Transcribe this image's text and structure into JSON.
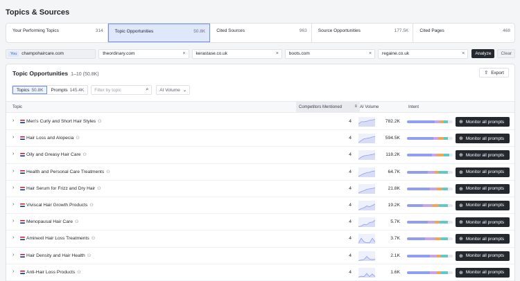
{
  "page": {
    "title": "Topics & Sources"
  },
  "tabs": [
    {
      "label": "Your Performing Topics",
      "count": "314"
    },
    {
      "label": "Topic Opportunities",
      "count": "50.8K",
      "active": true
    },
    {
      "label": "Cited Sources",
      "count": "963"
    },
    {
      "label": "Source Opportunities",
      "count": "177.5K"
    },
    {
      "label": "Cited Pages",
      "count": "468"
    }
  ],
  "domains": {
    "you_badge": "You",
    "you": "champohaircare.com",
    "competitors": [
      "theordinary.com",
      "kerastase.co.uk",
      "boots.com",
      "regaine.co.uk"
    ],
    "analyze_label": "Analyze",
    "clear_label": "Clear"
  },
  "panel": {
    "title": "Topic Opportunities",
    "range": "1–10 (50.8K)",
    "export_label": "Export",
    "filters": {
      "topics_label": "Topics",
      "topics_count": "50.8K",
      "prompts_label": "Prompts",
      "prompts_count": "145.4K",
      "search_placeholder": "Filter by topic",
      "volume_dropdown": "AI Volume"
    },
    "columns": {
      "topic": "Topic",
      "competitors": "Competitors Mentioned",
      "volume": "AI Volume",
      "intent": "Intent"
    },
    "monitor_label": "Monitor all prompts",
    "colors": {
      "accent": "#6e8fe8",
      "dark_button": "#24292f"
    },
    "rows": [
      {
        "topic": "Men's Curly and Short Hair Styles",
        "competitors": "4",
        "volume": "782.2K",
        "trend": [
          0.3,
          0.55,
          0.55,
          0.6,
          0.7,
          0.75,
          0.8
        ],
        "intent": [
          0.6,
          0.12,
          0.08,
          0.1,
          0.1
        ]
      },
      {
        "topic": "Hair Loss and Alopecia",
        "competitors": "4",
        "volume": "594.5K",
        "trend": [
          0.1,
          0.3,
          0.5,
          0.55,
          0.6,
          0.7,
          0.75
        ],
        "intent": [
          0.58,
          0.1,
          0.12,
          0.1,
          0.1
        ]
      },
      {
        "topic": "Oily and Greasy Hair Care",
        "competitors": "4",
        "volume": "118.2K",
        "trend": [
          0.1,
          0.3,
          0.45,
          0.5,
          0.55,
          0.6,
          0.7
        ],
        "intent": [
          0.55,
          0.1,
          0.15,
          0.12,
          0.08
        ]
      },
      {
        "topic": "Health and Personal Care Treatments",
        "competitors": "4",
        "volume": "64.7K",
        "trend": [
          0.1,
          0.25,
          0.4,
          0.5,
          0.55,
          0.65,
          0.7
        ],
        "intent": [
          0.45,
          0.15,
          0.1,
          0.2,
          0.1
        ]
      },
      {
        "topic": "Hair Serum for Frizz and Dry Hair",
        "competitors": "4",
        "volume": "21.8K",
        "trend": [
          0.1,
          0.25,
          0.35,
          0.5,
          0.55,
          0.6,
          0.65
        ],
        "intent": [
          0.5,
          0.15,
          0.12,
          0.13,
          0.1
        ]
      },
      {
        "topic": "Viviscal Hair Growth Products",
        "competitors": "4",
        "volume": "19.2K",
        "trend": [
          0.05,
          0.2,
          0.3,
          0.5,
          0.4,
          0.55,
          0.7
        ],
        "intent": [
          0.35,
          0.2,
          0.15,
          0.2,
          0.1
        ]
      },
      {
        "topic": "Menopausal Hair Care",
        "competitors": "4",
        "volume": "5.7K",
        "trend": [
          0.05,
          0.1,
          0.3,
          0.25,
          0.5,
          0.55,
          0.75
        ],
        "intent": [
          0.45,
          0.15,
          0.12,
          0.18,
          0.1
        ]
      },
      {
        "topic": "Aminexil Hair Loss Treatments",
        "competitors": "4",
        "volume": "3.7K",
        "trend": [
          0.05,
          0.6,
          0.2,
          0.1,
          0.1,
          0.6,
          0.2
        ],
        "intent": [
          0.4,
          0.2,
          0.15,
          0.15,
          0.1
        ]
      },
      {
        "topic": "Hair Density and Hair Health",
        "competitors": "4",
        "volume": "2.1K",
        "trend": [
          0.05,
          0.1,
          0.15,
          0.5,
          0.2,
          0.15,
          0.2
        ],
        "intent": [
          0.5,
          0.15,
          0.1,
          0.15,
          0.1
        ]
      },
      {
        "topic": "Anti-Hair Loss Products",
        "competitors": "4",
        "volume": "1.6K",
        "trend": [
          0.05,
          0.15,
          0.1,
          0.45,
          0.1,
          0.4,
          0.1
        ],
        "intent": [
          0.5,
          0.15,
          0.1,
          0.15,
          0.1
        ]
      }
    ],
    "intent_colors": [
      "#8f9ef0",
      "#c7a3ea",
      "#f0a35b",
      "#5fc9c3",
      "#e7e9ee"
    ]
  }
}
